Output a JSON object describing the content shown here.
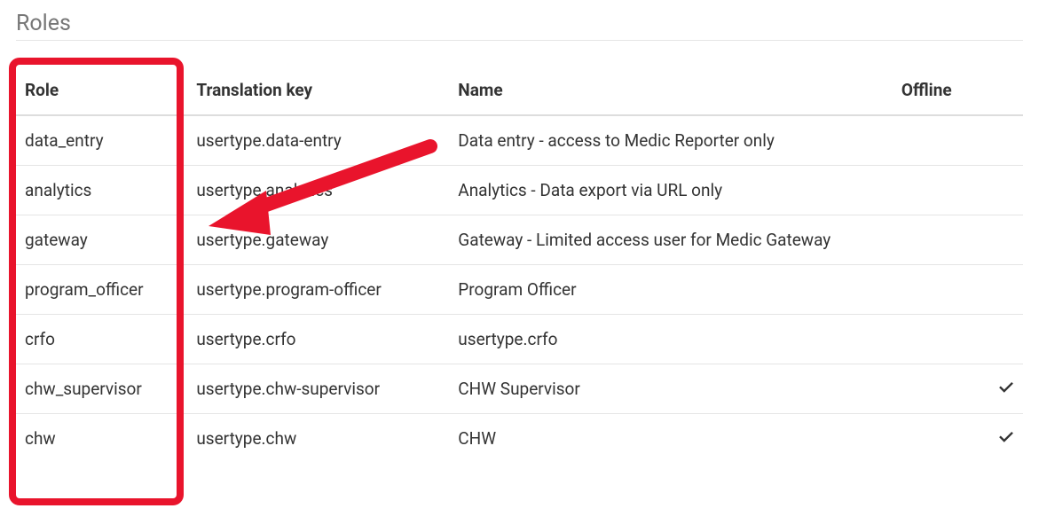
{
  "page": {
    "title": "Roles"
  },
  "table": {
    "headers": {
      "role": "Role",
      "translation_key": "Translation key",
      "name": "Name",
      "offline": "Offline"
    },
    "rows": [
      {
        "role": "data_entry",
        "translation_key": "usertype.data-entry",
        "name": "Data entry - access to Medic Reporter only",
        "offline": false
      },
      {
        "role": "analytics",
        "translation_key": "usertype.analytics",
        "name": "Analytics - Data export via URL only",
        "offline": false
      },
      {
        "role": "gateway",
        "translation_key": "usertype.gateway",
        "name": "Gateway - Limited access user for Medic Gateway",
        "offline": false
      },
      {
        "role": "program_officer",
        "translation_key": "usertype.program-officer",
        "name": "Program Officer",
        "offline": false
      },
      {
        "role": "crfo",
        "translation_key": "usertype.crfo",
        "name": "usertype.crfo",
        "offline": false
      },
      {
        "role": "chw_supervisor",
        "translation_key": "usertype.chw-supervisor",
        "name": "CHW Supervisor",
        "offline": true
      },
      {
        "role": "chw",
        "translation_key": "usertype.chw",
        "name": "CHW",
        "offline": true
      }
    ]
  },
  "annotation": {
    "highlight_column": "role",
    "arrow_color": "#e9142c"
  }
}
